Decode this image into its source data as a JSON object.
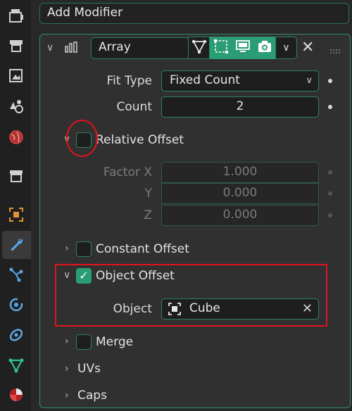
{
  "add_modifier_label": "Add Modifier",
  "modifier": {
    "name": "Array"
  },
  "fields": {
    "fit_type_label": "Fit Type",
    "fit_type_value": "Fixed Count",
    "count_label": "Count",
    "count_value": "2"
  },
  "relative_offset": {
    "label": "Relative Offset",
    "factor_x_label": "Factor X",
    "factor_x": "1.000",
    "y_label": "Y",
    "y": "0.000",
    "z_label": "Z",
    "z": "0.000"
  },
  "constant_offset_label": "Constant Offset",
  "object_offset": {
    "label": "Object Offset",
    "object_label": "Object",
    "object_value": "Cube"
  },
  "merge_label": "Merge",
  "uvs_label": "UVs",
  "caps_label": "Caps",
  "colors": {
    "accent": "#2a9d74",
    "highlight": "#e0141b"
  }
}
